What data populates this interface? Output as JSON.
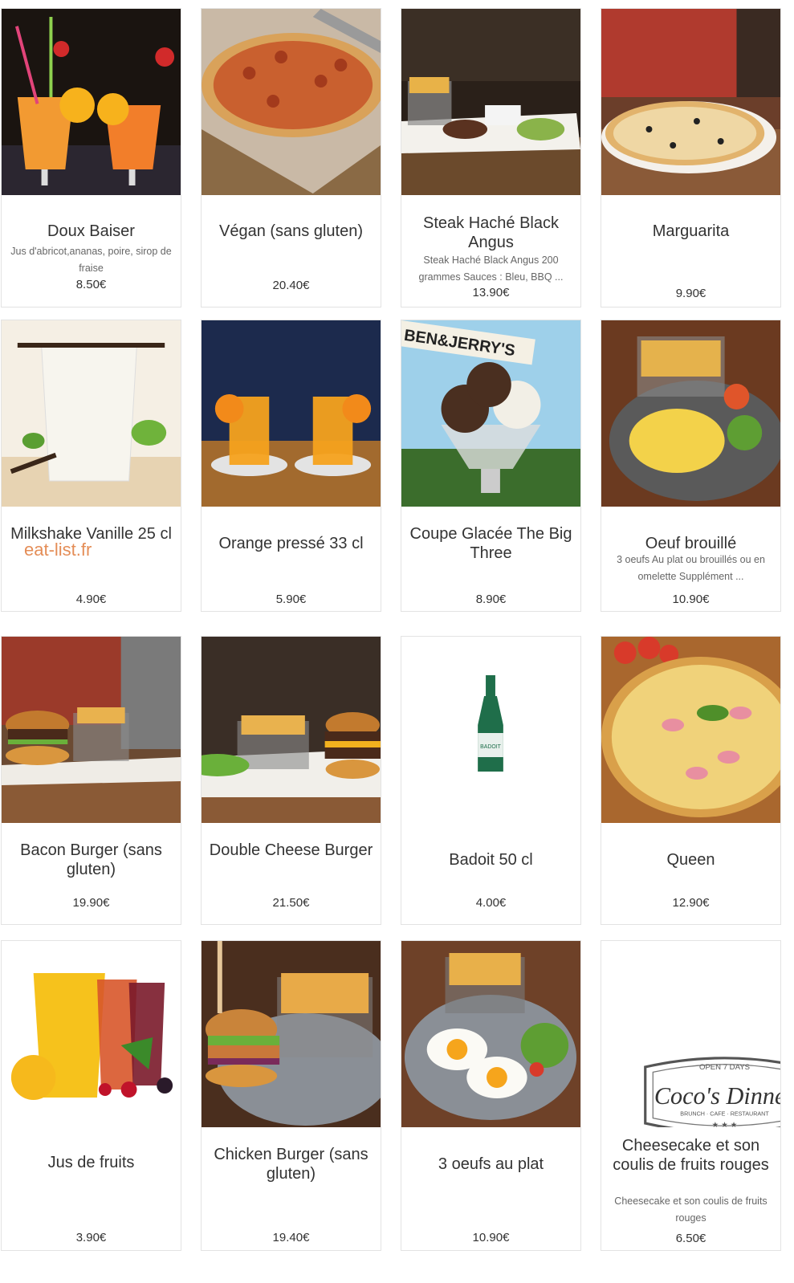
{
  "watermark": "eat-list.fr",
  "menu": {
    "items": [
      {
        "title": "Doux Baiser",
        "description": "Jus d'abricot,ananas, poire, sirop de fraise",
        "price": "8.50€",
        "icon": "cocktail-photo"
      },
      {
        "title": "Végan (sans gluten)",
        "description": "",
        "price": "20.40€",
        "icon": "pizza-photo"
      },
      {
        "title": "Steak Haché Black Angus",
        "description": "Steak Haché Black Angus 200 grammes Sauces : Bleu, BBQ ...",
        "price": "13.90€",
        "icon": "steak-fries-photo"
      },
      {
        "title": "Marguarita",
        "description": "",
        "price": "9.90€",
        "icon": "pizza-photo"
      },
      {
        "title": "Milkshake Vanille 25 cl",
        "description": "",
        "price": "4.90€",
        "icon": "milkshake-photo"
      },
      {
        "title": "Orange pressé 33 cl",
        "description": "",
        "price": "5.90€",
        "icon": "orange-juice-photo"
      },
      {
        "title": "Coupe Glacée The Big Three",
        "description": "",
        "price": "8.90€",
        "icon": "ice-cream-photo"
      },
      {
        "title": "Oeuf brouillé",
        "description": "3 oeufs Au plat ou brouillés ou en omelette Supplément ...",
        "price": "10.90€",
        "icon": "scrambled-eggs-photo"
      },
      {
        "title": "Bacon Burger (sans gluten)",
        "description": "",
        "price": "19.90€",
        "icon": "burger-photo"
      },
      {
        "title": "Double Cheese Burger",
        "description": "",
        "price": "21.50€",
        "icon": "burger-photo"
      },
      {
        "title": "Badoit 50 cl",
        "description": "",
        "price": "4.00€",
        "icon": "water-bottle-photo"
      },
      {
        "title": "Queen",
        "description": "",
        "price": "12.90€",
        "icon": "pizza-photo"
      },
      {
        "title": "Jus de fruits",
        "description": "",
        "price": "3.90€",
        "icon": "fruit-juice-photo"
      },
      {
        "title": "Chicken Burger (sans gluten)",
        "description": "",
        "price": "19.40€",
        "icon": "chicken-burger-photo"
      },
      {
        "title": "3 oeufs au plat",
        "description": "",
        "price": "10.90€",
        "icon": "fried-eggs-photo"
      },
      {
        "title": "Cheesecake et son coulis de fruits rouges",
        "description": "Cheesecake et son coulis de fruits rouges",
        "price": "6.50€",
        "icon": "restaurant-logo"
      }
    ]
  },
  "logo": {
    "top": "OPEN 7 DAYS",
    "name": "Coco's Dinner",
    "sub": "BRUNCH · CAFE · RESTAURANT"
  }
}
